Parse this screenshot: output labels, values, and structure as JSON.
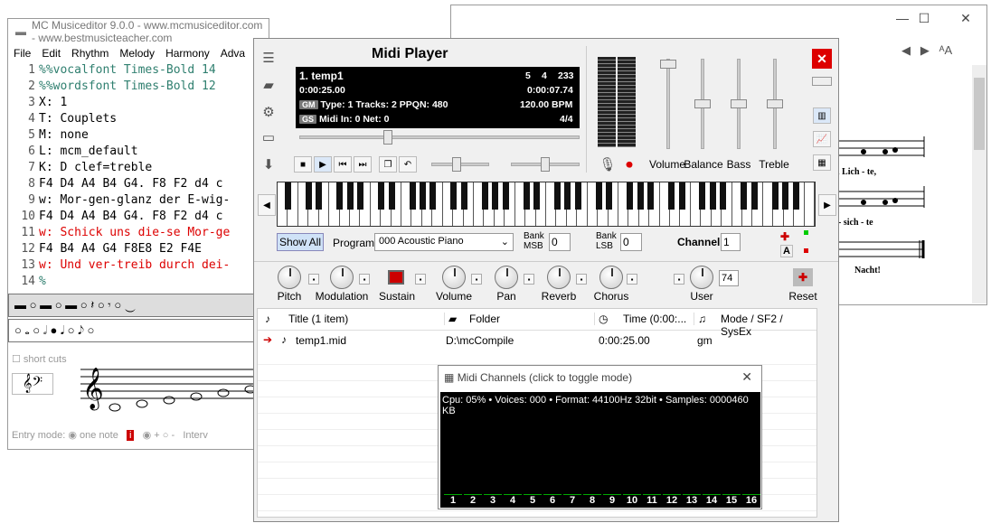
{
  "editor": {
    "title": "MC Musiceditor 9.0.0 - www.mcmusiceditor.com - www.bestmusicteacher.com",
    "menu": [
      "File",
      "Edit",
      "Rhythm",
      "Melody",
      "Harmony",
      "Adva"
    ],
    "lines": [
      {
        "n": "1",
        "t": "%%vocalfont Times-Bold 14",
        "c": "g"
      },
      {
        "n": "2",
        "t": "%%wordsfont Times-Bold 12",
        "c": "g"
      },
      {
        "n": "3",
        "t": "X: 1",
        "c": "k"
      },
      {
        "n": "4",
        "t": "T: Couplets",
        "c": "k"
      },
      {
        "n": "5",
        "t": "M: none",
        "c": "k"
      },
      {
        "n": "6",
        "t": "L: mcm_default",
        "c": "k"
      },
      {
        "n": "7",
        "t": "K: D clef=treble",
        "c": "k"
      },
      {
        "n": "8",
        "t": "F4 D4 A4 B4 G4. F8 F2 d4 c",
        "c": "k"
      },
      {
        "n": "9",
        "t": "w: Mor-gen-glanz der E-wig-",
        "c": "k"
      },
      {
        "n": "10",
        "t": "F4 D4 A4 B4 G4. F8 F2 d4 c",
        "c": "k"
      },
      {
        "n": "11",
        "t": "w: Schick uns die-se Mor-ge",
        "c": "r"
      },
      {
        "n": "12",
        "t": "F4 B4 A4 G4 F8E8 E2 F4E",
        "c": "k"
      },
      {
        "n": "13",
        "t": "w: Und ver-treib durch dei-",
        "c": "r"
      },
      {
        "n": "14",
        "t": "%",
        "c": "g"
      }
    ],
    "short_cuts": "short cuts",
    "entry_mode": "Entry mode:",
    "one_note": "one note",
    "interval": "Interv"
  },
  "score": {
    "lyrics": [
      "n Lich - te,",
      "- sich - te",
      "Nacht!"
    ]
  },
  "player": {
    "title": "Midi Player",
    "song": "1. temp1",
    "meter_a": "5",
    "meter_b": "4",
    "meter_c": "233",
    "time_a": "0:00:25.00",
    "time_b": "0:00:07.74",
    "gm": "GM",
    "info1": "Type: 1  Tracks: 2  PPQN: 480",
    "bpm": "120.00 BPM",
    "gs": "GS",
    "info2": "Midi In: 0  Net: 0",
    "sig": "4/4",
    "faders": [
      "Volume",
      "Balance",
      "Bass",
      "Treble"
    ],
    "show_all": "Show All",
    "program_label": "Program",
    "program": "000 Acoustic Piano",
    "bank_msb": "Bank MSB",
    "bank_lsb": "Bank LSB",
    "msb_val": "0",
    "lsb_val": "0",
    "channel_label": "Channel",
    "channel": "1",
    "knobs": [
      "Pitch",
      "Modulation",
      "Sustain",
      "Volume",
      "Pan",
      "Reverb",
      "Chorus",
      "User",
      "Reset"
    ],
    "user_val": "74",
    "cols": [
      "Title (1 item)",
      "Folder",
      "Time (0:00:...",
      "Mode / SF2 / SysEx"
    ],
    "row": [
      "temp1.mid",
      "D:\\mcCompile",
      "0:00:25.00",
      "gm"
    ]
  },
  "channels": {
    "title": "Midi Channels (click to toggle mode)",
    "status": "Cpu: 05% • Voices: 000 • Format: 44100Hz 32bit • Samples: 0000460 KB",
    "nums": [
      "1",
      "2",
      "3",
      "4",
      "5",
      "6",
      "7",
      "8",
      "9",
      "10",
      "11",
      "12",
      "13",
      "14",
      "15",
      "16"
    ]
  }
}
